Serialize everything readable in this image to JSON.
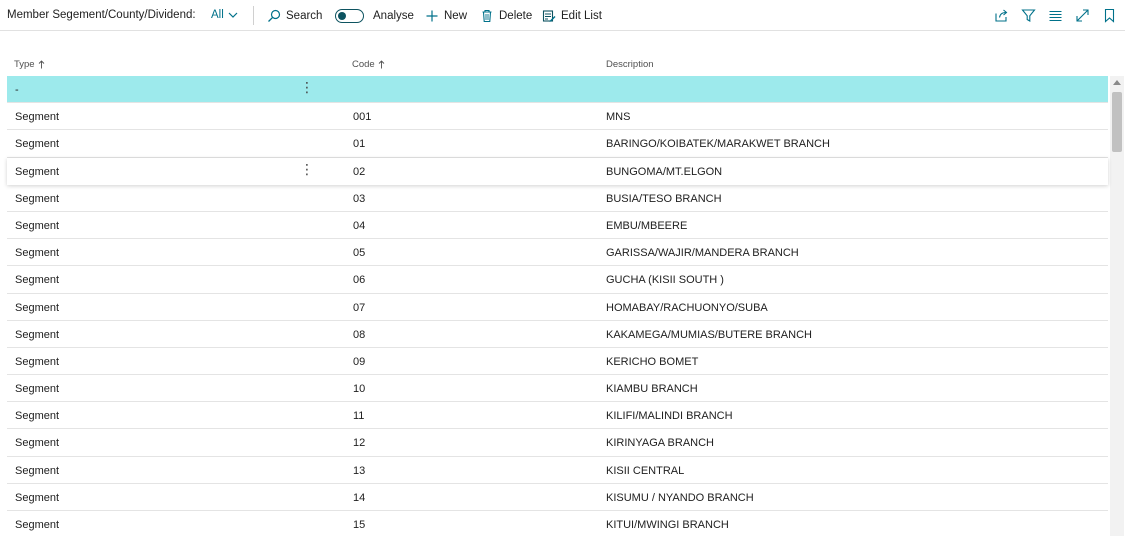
{
  "header": {
    "caption": "Member Segement/County/Dividend:",
    "view": "All",
    "actions": {
      "search": "Search",
      "analyse": "Analyse",
      "new": "New",
      "delete": "Delete",
      "edit_list": "Edit List"
    },
    "right_icons": [
      "share-icon",
      "filter-icon",
      "list-view-icon",
      "expand-icon",
      "bookmark-icon"
    ]
  },
  "grid": {
    "columns": [
      "Type",
      "Code",
      "Description"
    ],
    "rows": [
      {
        "type": "-",
        "code": "",
        "description": ""
      },
      {
        "type": "Segment",
        "code": "001",
        "description": "MNS"
      },
      {
        "type": "Segment",
        "code": "01",
        "description": "BARINGO/KOIBATEK/MARAKWET BRANCH"
      },
      {
        "type": "Segment",
        "code": "02",
        "description": "BUNGOMA/MT.ELGON"
      },
      {
        "type": "Segment",
        "code": "03",
        "description": "BUSIA/TESO BRANCH"
      },
      {
        "type": "Segment",
        "code": "04",
        "description": "EMBU/MBEERE"
      },
      {
        "type": "Segment",
        "code": "05",
        "description": "GARISSA/WAJIR/MANDERA BRANCH"
      },
      {
        "type": "Segment",
        "code": "06",
        "description": "GUCHA (KISII SOUTH )"
      },
      {
        "type": "Segment",
        "code": "07",
        "description": "HOMABAY/RACHUONYO/SUBA"
      },
      {
        "type": "Segment",
        "code": "08",
        "description": "KAKAMEGA/MUMIAS/BUTERE BRANCH"
      },
      {
        "type": "Segment",
        "code": "09",
        "description": "KERICHO BOMET"
      },
      {
        "type": "Segment",
        "code": "10",
        "description": "KIAMBU BRANCH"
      },
      {
        "type": "Segment",
        "code": "11",
        "description": "KILIFI/MALINDI BRANCH"
      },
      {
        "type": "Segment",
        "code": "12",
        "description": "KIRINYAGA BRANCH"
      },
      {
        "type": "Segment",
        "code": "13",
        "description": "KISII CENTRAL"
      },
      {
        "type": "Segment",
        "code": "14",
        "description": "KISUMU / NYANDO BRANCH"
      },
      {
        "type": "Segment",
        "code": "15",
        "description": "KITUI/MWINGI BRANCH"
      }
    ]
  },
  "colors": {
    "accent": "#00718a",
    "selected_row": "#9deaec",
    "toggle": "#0d5360"
  }
}
